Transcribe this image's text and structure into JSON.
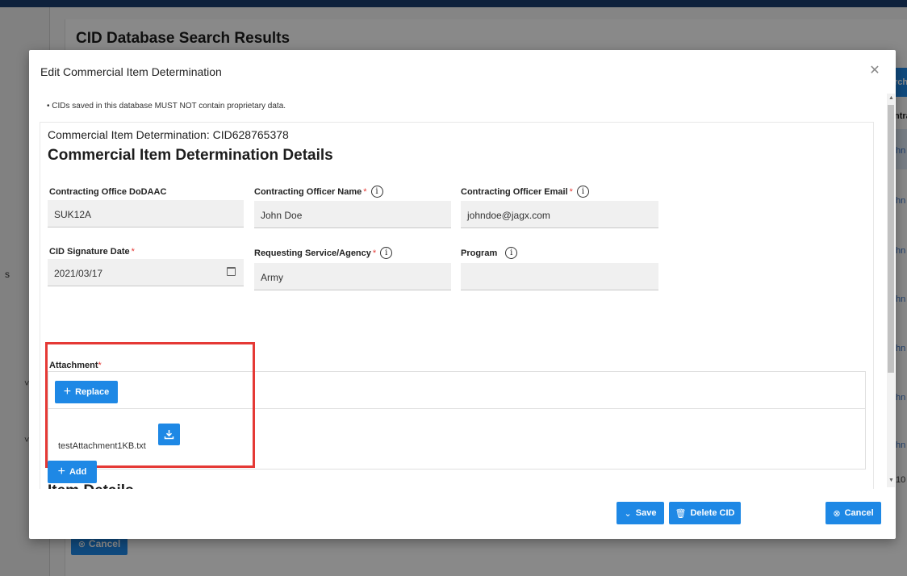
{
  "background": {
    "page_title": "CID Database Search Results",
    "side_fragment": "s",
    "search_fragment": "rch",
    "column_fragment": "ntra",
    "row_fragment": "hn D",
    "page_fragment": "10",
    "cancel_label": "Cancel"
  },
  "modal": {
    "title": "Edit Commercial Item Determination",
    "close_icon": "close-icon",
    "notice": "CIDs saved in this database MUST NOT contain proprietary data.",
    "cid_label": "Commercial Item Determination: CID628765378",
    "details_heading": "Commercial Item Determination Details",
    "fields": {
      "office_dodaac": {
        "label": "Contracting Office DoDAAC",
        "value": "SUK12A"
      },
      "officer_name": {
        "label": "Contracting Officer Name",
        "value": "John Doe",
        "required": "*"
      },
      "officer_email": {
        "label": "Contracting Officer Email",
        "value": "johndoe@jagx.com",
        "required": "*"
      },
      "signature_date": {
        "label": "CID Signature Date",
        "value": "2021/03/17",
        "required": "*"
      },
      "requesting_agency": {
        "label": "Requesting Service/Agency",
        "value": "Army",
        "required": "*"
      },
      "program": {
        "label": "Program",
        "value": ""
      }
    },
    "attachment": {
      "label": "Attachment",
      "required": "*",
      "replace_label": "Replace",
      "filename": "testAttachment1KB.txt"
    },
    "item_details": {
      "heading": "Item Details",
      "add_label": "Add"
    },
    "footer": {
      "save_label": "Save",
      "delete_label": "Delete CID",
      "cancel_label": "Cancel"
    }
  },
  "colors": {
    "primary": "#1e88e5",
    "required": "#e53935",
    "highlight": "#e53935",
    "topbar": "#1b3d6e"
  }
}
